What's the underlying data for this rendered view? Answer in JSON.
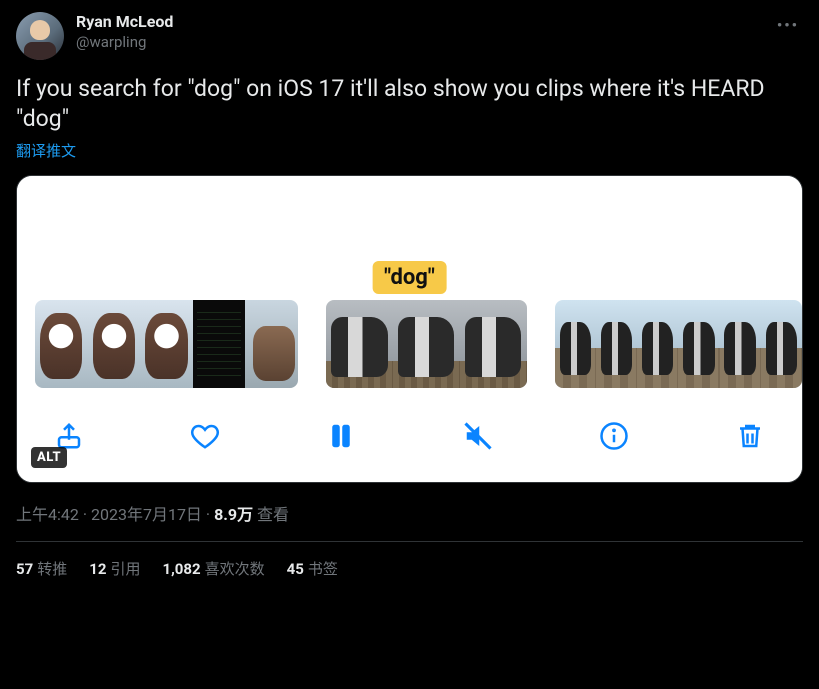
{
  "author": {
    "display_name": "Ryan McLeod",
    "handle": "@warpling"
  },
  "body_text": "If you search for \"dog\" on iOS 17 it'll also show you clips where it's HEARD \"dog\"",
  "translate_label": "翻译推文",
  "media": {
    "caption_chip": "\"dog\"",
    "alt_badge": "ALT"
  },
  "meta": {
    "time": "上午4:42",
    "date": "2023年7月17日",
    "views_count": "8.9万",
    "views_label": "查看"
  },
  "stats": {
    "retweets": {
      "count": "57",
      "label": "转推"
    },
    "quotes": {
      "count": "12",
      "label": "引用"
    },
    "likes": {
      "count": "1,082",
      "label": "喜欢次数"
    },
    "bookmarks": {
      "count": "45",
      "label": "书签"
    }
  }
}
